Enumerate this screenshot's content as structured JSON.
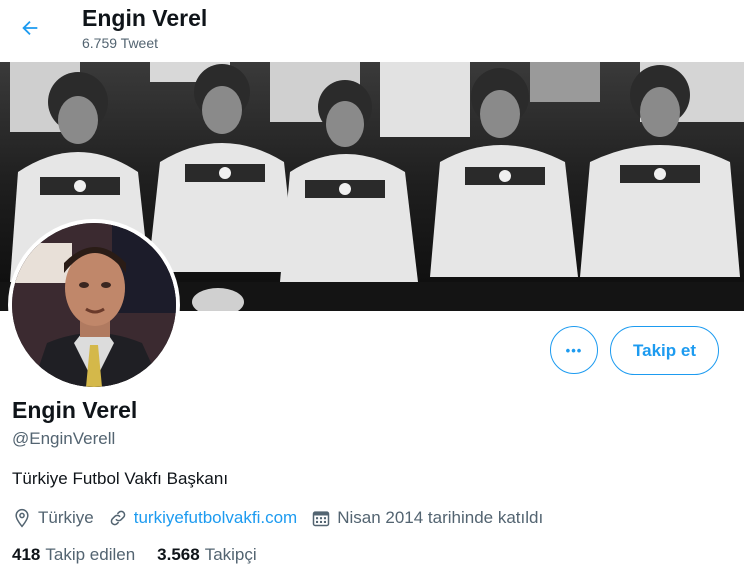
{
  "header": {
    "name": "Engin Verel",
    "tweet_count": "6.759 Tweet"
  },
  "profile": {
    "display_name": "Engin Verel",
    "handle": "@EnginVerell",
    "bio": "Türkiye Futbol Vakfı Başkanı",
    "location": "Türkiye",
    "website": "turkiyefutbolvakfi.com",
    "joined": "Nisan 2014 tarihinde katıldı"
  },
  "actions": {
    "more_label": "•••",
    "follow_label": "Takip et"
  },
  "stats": {
    "following_count": "418",
    "following_label": "Takip edilen",
    "followers_count": "3.568",
    "followers_label": "Takipçi"
  },
  "colors": {
    "accent": "#1d9bf0",
    "secondary_text": "#536471",
    "primary_text": "#0f1419"
  },
  "icons": [
    "back-arrow-icon",
    "location-icon",
    "link-icon",
    "calendar-icon"
  ]
}
